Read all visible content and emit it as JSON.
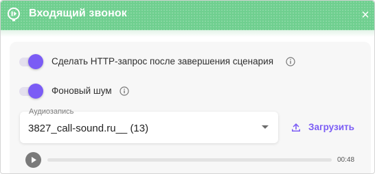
{
  "header": {
    "title": "Входящий звонок",
    "close_symbol": "×",
    "icon": "incoming-call-icon",
    "color": "#6fcf8f"
  },
  "settings": {
    "http_request": {
      "label": "Сделать HTTP-запрос после завершения сценария",
      "enabled": true
    },
    "background_noise": {
      "label": "Фоновый шум",
      "enabled": true
    }
  },
  "audio": {
    "legend": "Аудиозапись",
    "selected_value": "3827_call-sound.ru__ (13)",
    "upload_label": "Загрузить",
    "duration": "00:48",
    "progress": 0
  },
  "colors": {
    "accent": "#7b5cf5",
    "header": "#6fcf8f"
  }
}
